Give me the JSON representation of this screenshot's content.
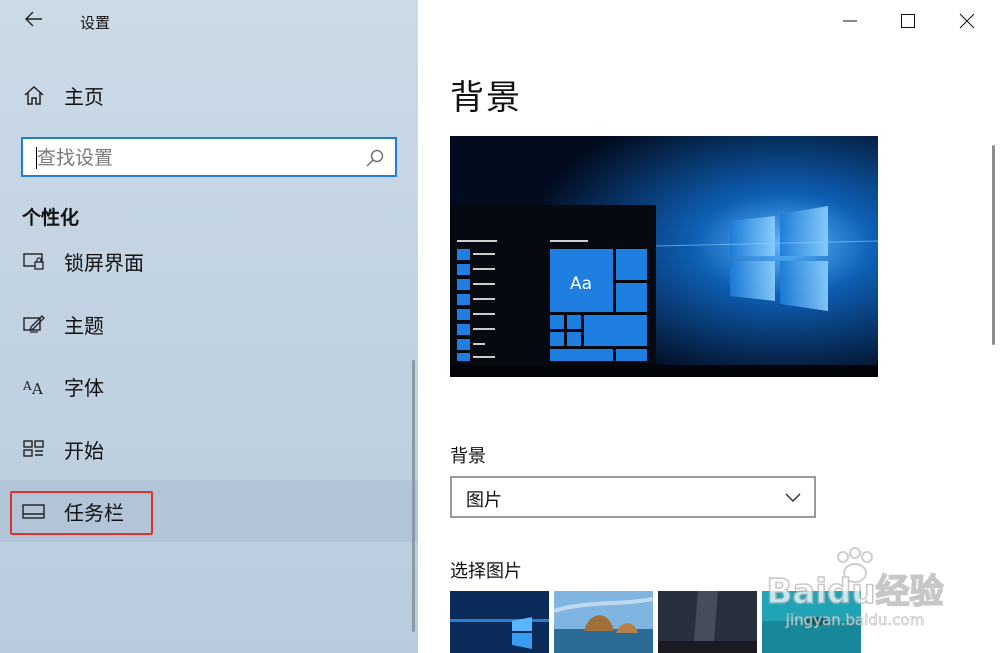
{
  "window": {
    "title": "设置"
  },
  "sidebar": {
    "home_label": "主页",
    "search": {
      "placeholder": "查找设置"
    },
    "section_title": "个性化",
    "items": [
      {
        "label": "锁屏界面",
        "icon": "lock-screen-icon"
      },
      {
        "label": "主题",
        "icon": "theme-icon"
      },
      {
        "label": "字体",
        "icon": "font-icon"
      },
      {
        "label": "开始",
        "icon": "start-icon"
      },
      {
        "label": "任务栏",
        "icon": "taskbar-icon",
        "selected": true
      }
    ]
  },
  "main": {
    "heading": "背景",
    "preview_sample_text": "Aa",
    "background_label": "背景",
    "background_type": {
      "selected": "图片"
    },
    "choose_picture_label": "选择图片"
  },
  "watermark": {
    "brand": "Baidu经验",
    "url": "jingyan.baidu.com"
  },
  "colors": {
    "accent": "#0078d7",
    "highlight_border": "#e0312b",
    "sidebar_bg": "#c3d4e4"
  }
}
